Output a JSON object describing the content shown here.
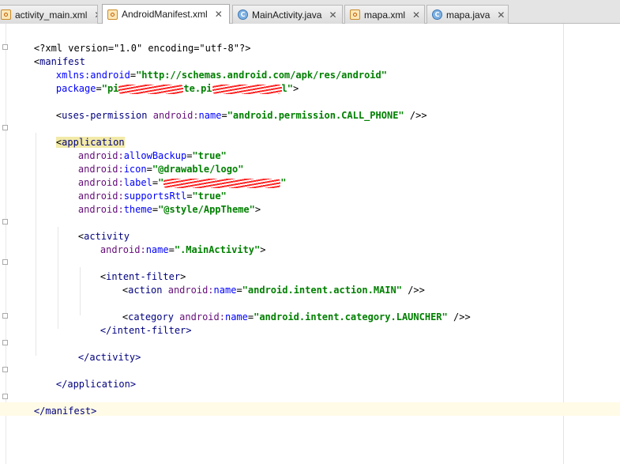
{
  "tabs": [
    {
      "label": "activity_main.xml",
      "icon": "xml-file-icon",
      "active": false
    },
    {
      "label": "AndroidManifest.xml",
      "icon": "xml-file-icon",
      "active": true
    },
    {
      "label": "MainActivity.java",
      "icon": "java-class-icon",
      "active": false
    },
    {
      "label": "mapa.xml",
      "icon": "xml-file-icon",
      "active": false
    },
    {
      "label": "mapa.java",
      "icon": "java-class-icon",
      "active": false
    }
  ],
  "close_glyph": "✕",
  "class_glyph": "C",
  "code": {
    "xml_decl": "<?xml version=\"1.0\" encoding=\"utf-8\"?>",
    "manifest_open": "manifest",
    "xmlns_ns": "xmlns:",
    "xmlns_attr": "android",
    "xmlns_val": "\"http://schemas.android.com/apk/res/android\"",
    "package_attr": "package",
    "package_val_visible": "\"pi",
    "package_val_mid": "te.pi",
    "package_val_end": "l\"",
    "uses_permission_tag": "uses-permission",
    "android_ns": "android:",
    "name_attr": "name",
    "call_phone_val": "\"android.permission.CALL_PHONE\"",
    "application_tag": "application",
    "allow_backup_attr": "allowBackup",
    "allow_backup_val": "\"true\"",
    "icon_attr": "icon",
    "icon_val": "\"@drawable/logo\"",
    "label_attr": "label",
    "label_val_open": "\"",
    "label_val_close": "\"",
    "supports_rtl_attr": "supportsRtl",
    "supports_rtl_val": "\"true\"",
    "theme_attr": "theme",
    "theme_val": "\"@style/AppTheme\"",
    "activity_tag": "activity",
    "main_activity_val": "\".MainActivity\"",
    "intent_filter_tag": "intent-filter",
    "action_tag": "action",
    "action_main_val": "\"android.intent.action.MAIN\"",
    "category_tag": "category",
    "category_launcher_val": "\"android.intent.category.LAUNCHER\"",
    "activity_close": "</activity>",
    "intent_filter_close": "</intent-filter>",
    "application_close": "</application>",
    "manifest_close": "</manifest>",
    "lt": "<",
    "gt": ">",
    "eq": "=",
    "self_close": " />"
  }
}
